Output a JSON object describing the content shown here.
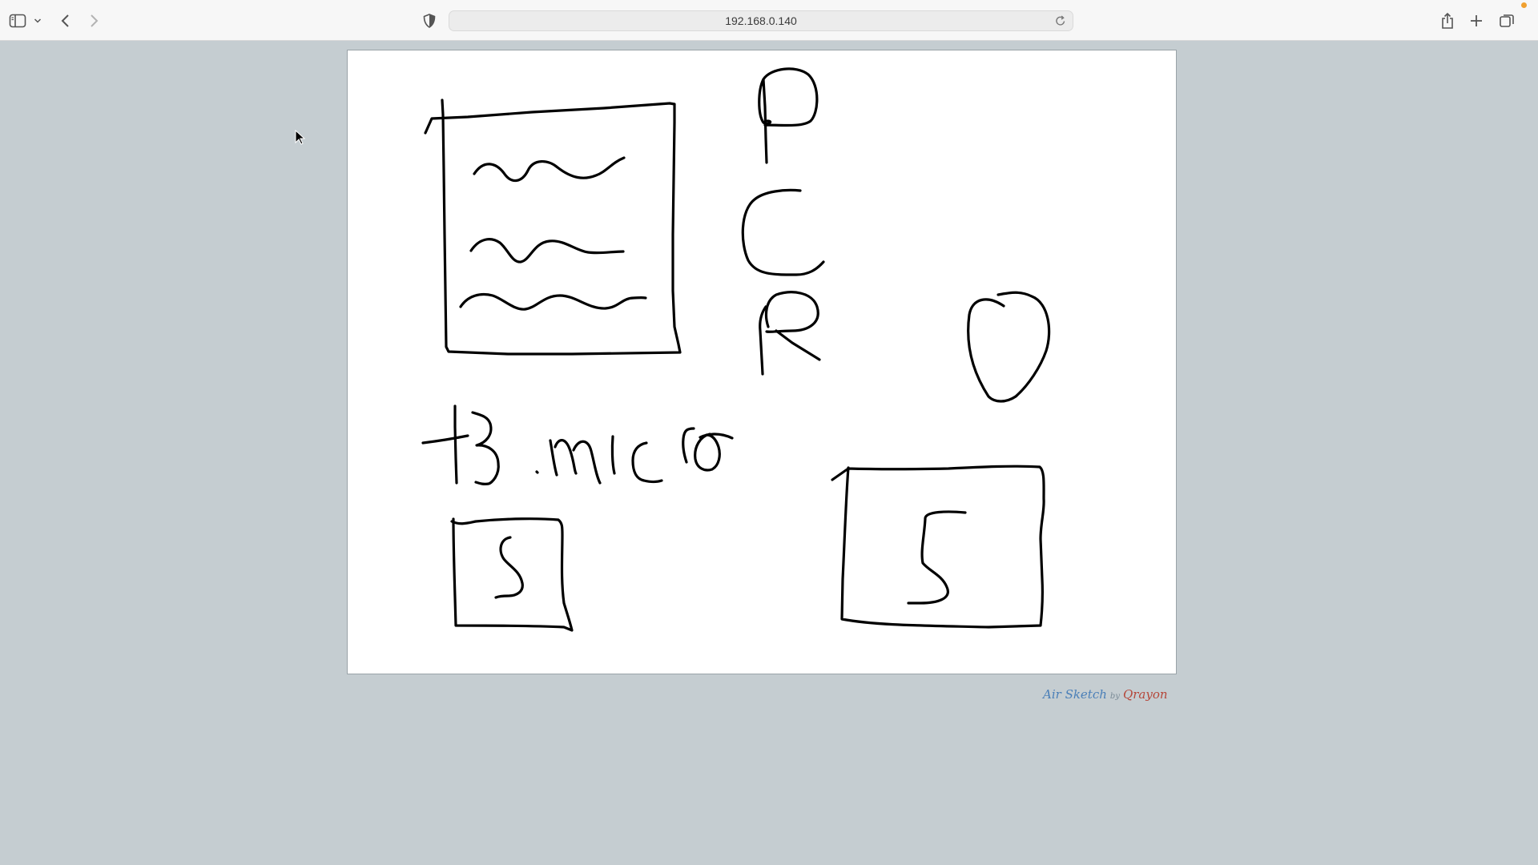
{
  "browser": {
    "url": "192.168.0.140",
    "icons": {
      "sidebar": "sidebar-icon",
      "tab_menu": "chevron-down-icon",
      "back": "chevron-left-icon",
      "forward": "chevron-right-icon",
      "privacy": "shield-icon",
      "reload": "reload-icon",
      "share": "share-icon",
      "new_tab": "plus-icon",
      "tab_overview": "tabs-icon"
    },
    "accent_dot_color": "#f0a030"
  },
  "sketch": {
    "letters": [
      "P",
      "C",
      "R"
    ],
    "caption": "t3.micro",
    "box_labels": [
      "S",
      "S"
    ]
  },
  "footer": {
    "app_name": "Air Sketch",
    "by": "by",
    "company": "Qrayon"
  },
  "colors": {
    "background": "#c5cdd1",
    "canvas": "#ffffff",
    "ink": "#000000",
    "credit_app": "#4a7fb8",
    "credit_company": "#b5473a"
  }
}
